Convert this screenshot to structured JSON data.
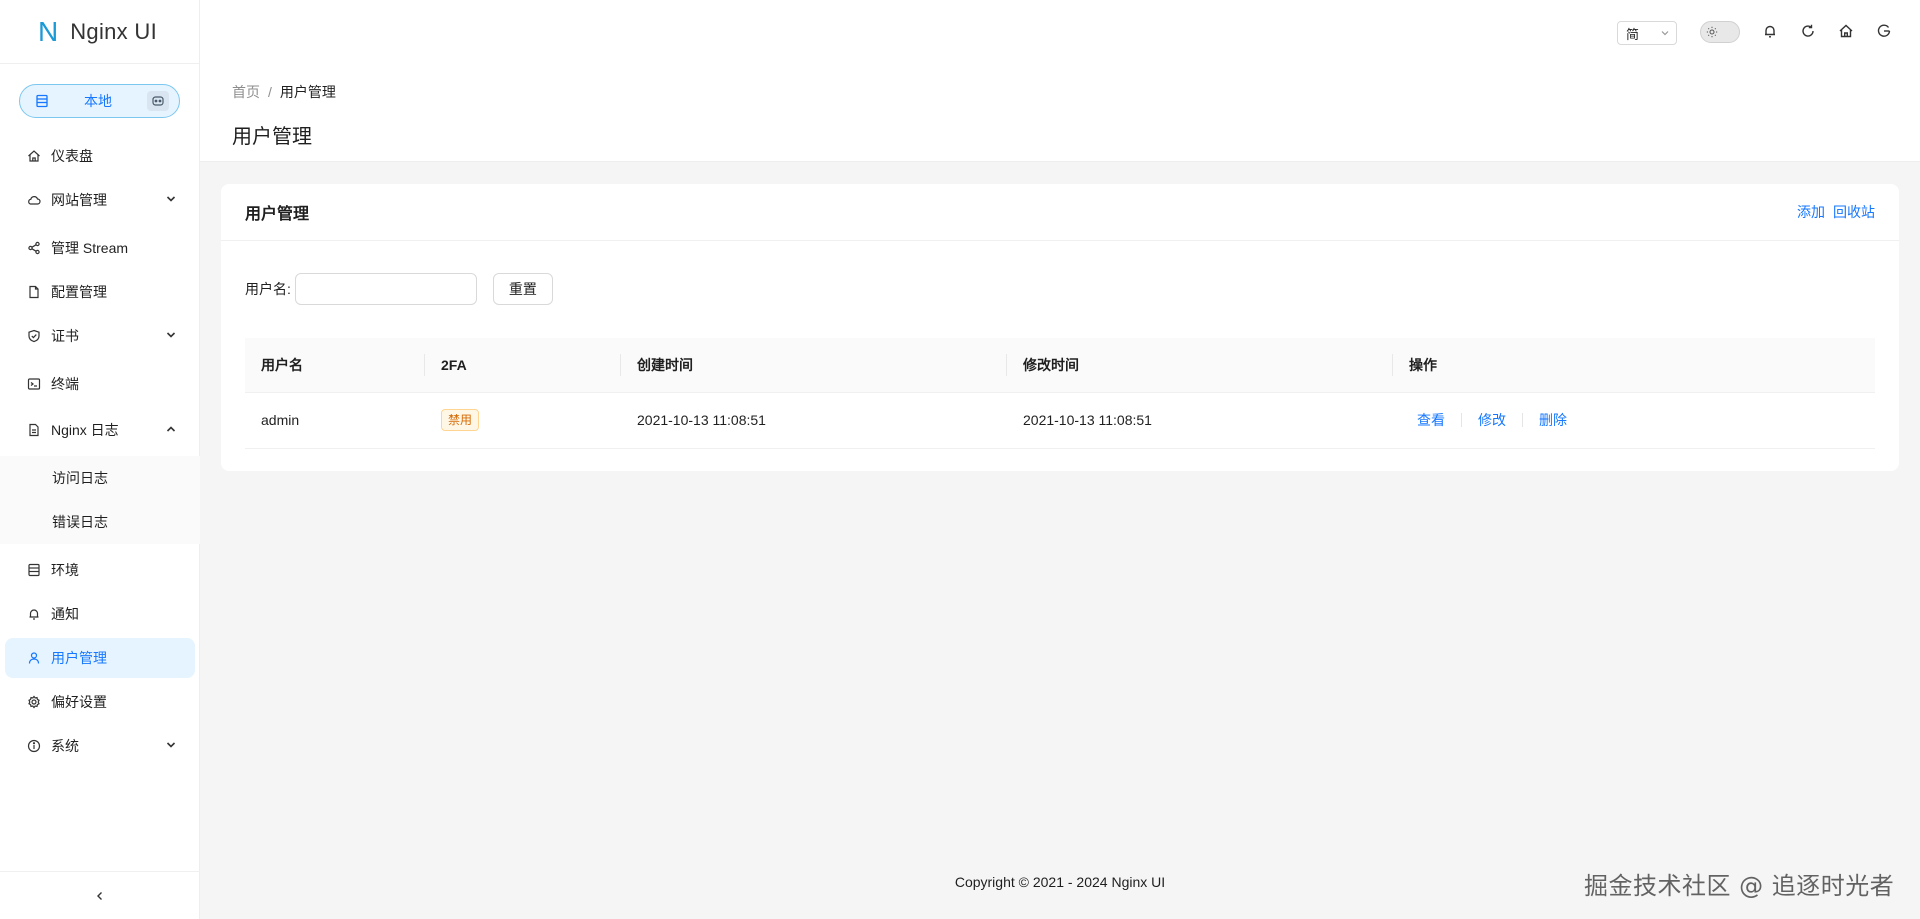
{
  "app": {
    "logo_mark": "N",
    "name": "Nginx UI"
  },
  "env": {
    "label": "本地"
  },
  "sidebar": {
    "items": [
      {
        "label": "仪表盘"
      },
      {
        "label": "网站管理"
      },
      {
        "label": "管理 Stream"
      },
      {
        "label": "配置管理"
      },
      {
        "label": "证书"
      },
      {
        "label": "终端"
      },
      {
        "label": "Nginx 日志"
      },
      {
        "label": "访问日志"
      },
      {
        "label": "错误日志"
      },
      {
        "label": "环境"
      },
      {
        "label": "通知"
      },
      {
        "label": "用户管理"
      },
      {
        "label": "偏好设置"
      },
      {
        "label": "系统"
      }
    ]
  },
  "header": {
    "language": "简"
  },
  "breadcrumb": {
    "home": "首页",
    "separator": "/",
    "current": "用户管理"
  },
  "page": {
    "title": "用户管理"
  },
  "card": {
    "title": "用户管理",
    "add": "添加",
    "trash": "回收站",
    "search": {
      "label": "用户名:",
      "value": "",
      "reset": "重置"
    },
    "table": {
      "columns": [
        "用户名",
        "2FA",
        "创建时间",
        "修改时间",
        "操作"
      ],
      "rows": [
        {
          "username": "admin",
          "twofa": "禁用",
          "created": "2021-10-13 11:08:51",
          "updated": "2021-10-13 11:08:51",
          "actions": {
            "view": "查看",
            "edit": "修改",
            "delete": "删除"
          }
        }
      ]
    }
  },
  "footer": {
    "copyright": "Copyright © 2021 - 2024 Nginx UI"
  },
  "watermark": "掘金技术社区 @ 追逐时光者",
  "colors": {
    "primary": "#1677ff",
    "logo": "#1c9ad6",
    "tag_warn": "#d46b08"
  }
}
